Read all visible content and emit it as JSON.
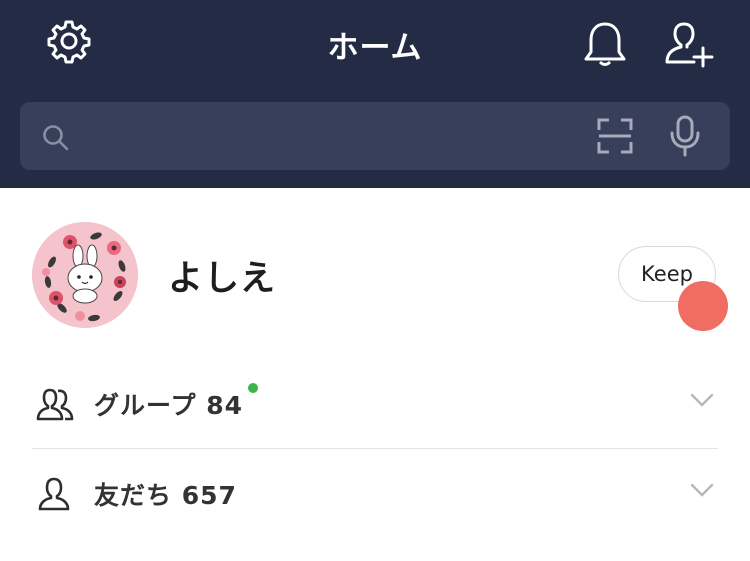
{
  "header": {
    "title": "ホーム",
    "icons": {
      "settings": "gear-icon",
      "notifications": "bell-icon",
      "add_friend": "add-friend-icon"
    },
    "background_color": "#232b45"
  },
  "search": {
    "placeholder": "",
    "value": "",
    "icons": [
      "search-icon",
      "scan-icon",
      "microphone-icon"
    ],
    "background_color": "#373f5a"
  },
  "profile": {
    "name": "よしえ",
    "avatar": "bunny-flower-wreath-avatar",
    "keep_label": "Keep"
  },
  "lists": [
    {
      "label": "グループ 84",
      "icon": "group-icon",
      "has_new_badge": true
    },
    {
      "label": "友だち 657",
      "icon": "friend-icon",
      "has_new_badge": false
    }
  ],
  "colors": {
    "touch_indicator": "#f06d63",
    "new_badge": "#3bb54a"
  }
}
